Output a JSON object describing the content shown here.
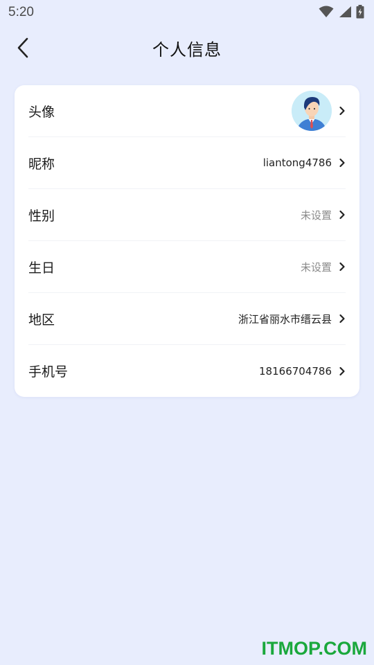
{
  "status_bar": {
    "time": "5:20"
  },
  "header": {
    "title": "个人信息"
  },
  "profile": {
    "rows": [
      {
        "label": "头像",
        "value": ""
      },
      {
        "label": "昵称",
        "value": "liantong4786"
      },
      {
        "label": "性别",
        "value": "未设置"
      },
      {
        "label": "生日",
        "value": "未设置"
      },
      {
        "label": "地区",
        "value": "浙江省丽水市缙云县"
      },
      {
        "label": "手机号",
        "value": "18166704786"
      }
    ]
  },
  "watermark": "ITMOP.COM",
  "colors": {
    "background": "#e8edfd",
    "card": "#ffffff",
    "watermark": "#1aa83c"
  }
}
